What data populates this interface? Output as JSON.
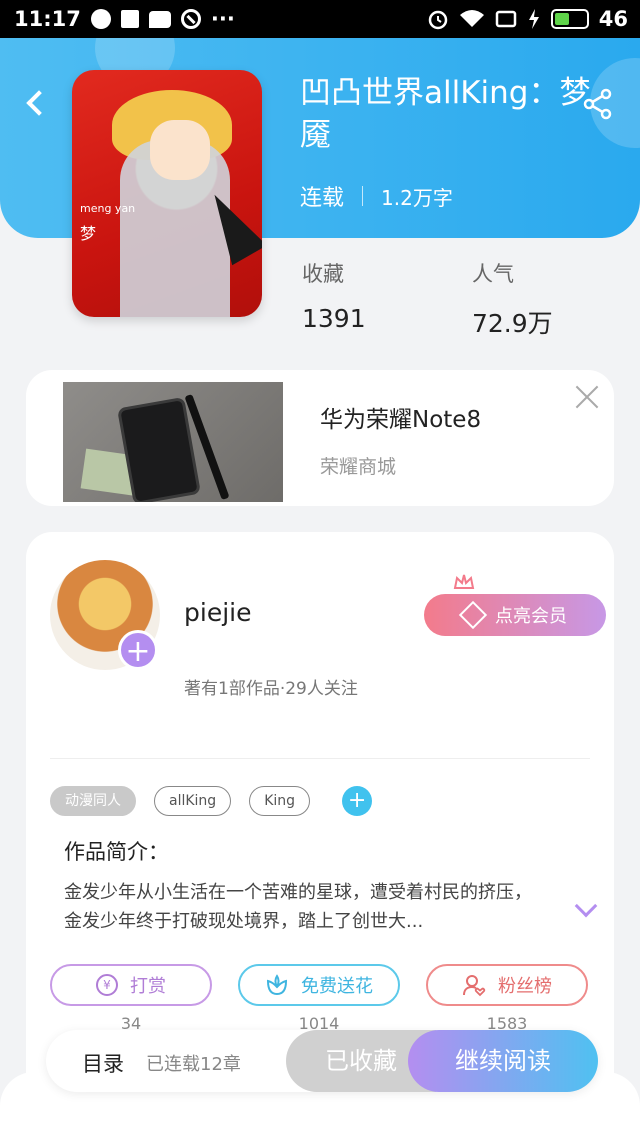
{
  "status_bar": {
    "time": "11:17",
    "dots": "···",
    "battery": "46",
    "battery_level": 0.46
  },
  "header": {
    "title": "凹凸世界allKing：梦魇",
    "status": "连载",
    "word_count": "1.2万字",
    "back_icon": "back-arrow-icon",
    "share_icon": "share-icon"
  },
  "cover": {
    "text_en": "meng yan",
    "text_cn": "梦"
  },
  "stats": [
    {
      "label": "收藏",
      "value": "1391"
    },
    {
      "label": "人气",
      "value": "72.9万"
    }
  ],
  "ad": {
    "title": "华为荣耀Note8",
    "subtitle": "荣耀商城"
  },
  "author": {
    "name": "piejie",
    "meta": "著有1部作品·29人关注",
    "vip_label": "点亮会员"
  },
  "tags": [
    "动漫同人",
    "allKing",
    "King"
  ],
  "intro": {
    "title": "作品简介：",
    "text": "金发少年从小生活在一个苦难的星球，遭受着村民的挤压，金发少年终于打破现处境界，踏上了创世大..."
  },
  "actions": [
    {
      "label": "打赏",
      "count": "34",
      "icon": "yen-coin-icon"
    },
    {
      "label": "免费送花",
      "count": "1014",
      "icon": "flower-icon"
    },
    {
      "label": "粉丝榜",
      "count": "1583",
      "icon": "user-heart-icon"
    }
  ],
  "bottom_bar": {
    "toc": "目录",
    "chapter_status": "已连载12章",
    "collected": "已收藏",
    "continue": "继续阅读"
  },
  "colors": {
    "header_blue": "#2aa9ee",
    "accent_purple": "#b48ef0",
    "vip_pink": "#f37b8b"
  }
}
